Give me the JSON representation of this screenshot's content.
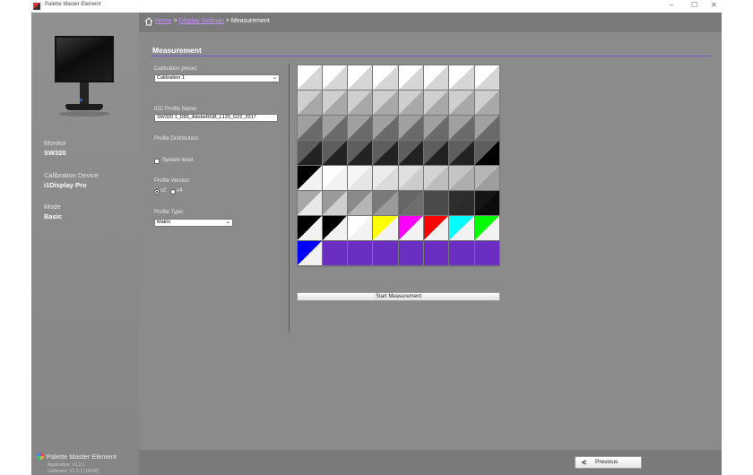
{
  "window": {
    "title": "Palette Master Element",
    "minimize": "–",
    "maximize": "☐",
    "close": "✕"
  },
  "breadcrumb": {
    "home": "Home",
    "sep1": ">",
    "display_settings": "Display Settings",
    "sep2": ">",
    "current": "Measurement"
  },
  "sidebar": {
    "monitor_label": "Monitor",
    "monitor_value": "SW320",
    "device_label": "Calibration Device",
    "device_value": "i1Display Pro",
    "mode_label": "Mode",
    "mode_value": "Basic",
    "brand": "Palette Master Element",
    "app_version": "Application: V1.2.1",
    "calibrator_version": "Calibrator: V1.2.1 (10140)"
  },
  "page": {
    "title": "Measurement"
  },
  "form": {
    "calibration_preset_label": "Calibration preset:",
    "calibration_preset_value": "Calibration 1",
    "icc_label": "ICC Profile Name:",
    "icc_value": "SW320 1_D65_AdobeRGB_L120_G22_2017",
    "distribution_label": "Profile Distribution:",
    "system_level_label": "System level",
    "version_label": "Profile Version:",
    "version_v2": "v2",
    "version_v4": "v4",
    "version_selected": "v2",
    "type_label": "Profile Type:",
    "type_value": "Matrix"
  },
  "patches": {
    "rows": [
      [
        [
          "#ffffff",
          "#d6d6d6"
        ],
        [
          "#ffffff",
          "#d6d6d6"
        ],
        [
          "#ffffff",
          "#d6d6d6"
        ],
        [
          "#ffffff",
          "#d6d6d6"
        ],
        [
          "#ffffff",
          "#d6d6d6"
        ],
        [
          "#ffffff",
          "#d6d6d6"
        ],
        [
          "#ffffff",
          "#d6d6d6"
        ],
        [
          "#ffffff",
          "#d6d6d6"
        ]
      ],
      [
        [
          "#cfcfcf",
          "#a8a8a8"
        ],
        [
          "#cfcfcf",
          "#a8a8a8"
        ],
        [
          "#cfcfcf",
          "#a8a8a8"
        ],
        [
          "#cfcfcf",
          "#a8a8a8"
        ],
        [
          "#cfcfcf",
          "#a8a8a8"
        ],
        [
          "#cfcfcf",
          "#a8a8a8"
        ],
        [
          "#cfcfcf",
          "#a8a8a8"
        ],
        [
          "#cfcfcf",
          "#a8a8a8"
        ]
      ],
      [
        [
          "#a0a0a0",
          "#6a6a6a"
        ],
        [
          "#a0a0a0",
          "#6a6a6a"
        ],
        [
          "#a0a0a0",
          "#6a6a6a"
        ],
        [
          "#a0a0a0",
          "#6a6a6a"
        ],
        [
          "#a0a0a0",
          "#6a6a6a"
        ],
        [
          "#a0a0a0",
          "#6a6a6a"
        ],
        [
          "#a0a0a0",
          "#6a6a6a"
        ],
        [
          "#a0a0a0",
          "#6a6a6a"
        ]
      ],
      [
        [
          "#5e5e5e",
          "#222222"
        ],
        [
          "#5e5e5e",
          "#222222"
        ],
        [
          "#5e5e5e",
          "#222222"
        ],
        [
          "#5e5e5e",
          "#222222"
        ],
        [
          "#5e5e5e",
          "#222222"
        ],
        [
          "#5e5e5e",
          "#222222"
        ],
        [
          "#5e5e5e",
          "#222222"
        ],
        [
          "#5e5e5e",
          "#000000"
        ]
      ],
      [
        [
          "#000000",
          "#f2f2f2"
        ],
        [
          "#ffffff",
          "#f2f2f2"
        ],
        [
          "#f5f5f5",
          "#e6e6e6"
        ],
        [
          "#ececec",
          "#dadada"
        ],
        [
          "#e0e0e0",
          "#cccccc"
        ],
        [
          "#d3d3d3",
          "#bdbdbd"
        ],
        [
          "#c4c4c4",
          "#aeaeae"
        ],
        [
          "#b6b6b6",
          "#9e9e9e"
        ]
      ],
      [
        [
          "#a8a8a8",
          "#e8e8e8"
        ],
        [
          "#9a9a9a",
          "#cfcfcf"
        ],
        [
          "#8a8a8a",
          "#b5b5b5"
        ],
        [
          "#7a7a7a",
          "#9a9a9a"
        ],
        [
          "#666666",
          "#6e6e6e"
        ],
        [
          "#4a4a4a",
          "#4a4a4a"
        ],
        [
          "#2e2e2e",
          "#2c2c2c"
        ],
        [
          "#151515",
          "#0c0c0c"
        ]
      ],
      [
        [
          "#000000",
          "#f2f2f2"
        ],
        [
          "#000000",
          "#f2f2f2"
        ],
        [
          "#ffffff",
          "#f2f2f2"
        ],
        [
          "#ffff00",
          "#f2f2f2"
        ],
        [
          "#ff00ff",
          "#f2f2f2"
        ],
        [
          "#ff0000",
          "#f2f2f2"
        ],
        [
          "#00ffff",
          "#f2f2f2"
        ],
        [
          "#00ff00",
          "#f2f2f2"
        ]
      ],
      [
        [
          "#0000ff",
          "#f2f2f2"
        ],
        [
          "#6a2fc0",
          "#6a2fc0"
        ],
        [
          "#6a2fc0",
          "#6a2fc0"
        ],
        [
          "#6a2fc0",
          "#6a2fc0"
        ],
        [
          "#6a2fc0",
          "#6a2fc0"
        ],
        [
          "#6a2fc0",
          "#6a2fc0"
        ],
        [
          "#6a2fc0",
          "#6a2fc0"
        ],
        [
          "#6a2fc0",
          "#6a2fc0"
        ]
      ]
    ]
  },
  "actions": {
    "start": "Start Measurement",
    "previous": "Previous",
    "previous_icon": "chevron-left-icon"
  },
  "colors": {
    "accent": "#7b4fd0",
    "link": "#c58cff",
    "panel": "#8b8b8b",
    "sidebar": "#8a8a8a"
  }
}
